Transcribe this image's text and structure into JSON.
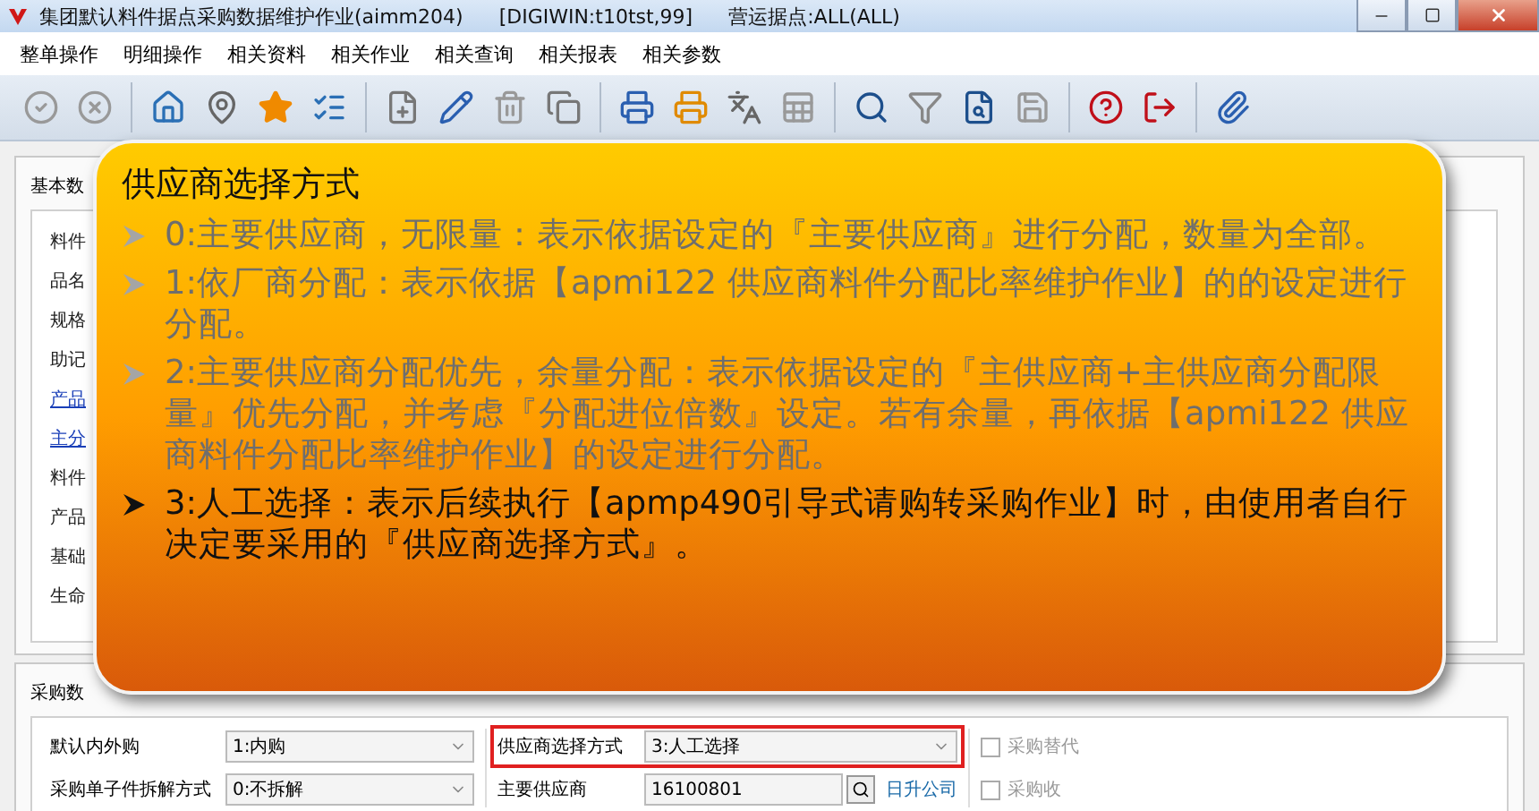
{
  "window": {
    "title": "集团默认料件据点采购数据维护作业(aimm204)",
    "connection": "[DIGIWIN:t10tst,99]",
    "site": "营运据点:ALL(ALL)"
  },
  "menu": [
    "整单操作",
    "明细操作",
    "相关资料",
    "相关作业",
    "相关查询",
    "相关报表",
    "相关参数"
  ],
  "basic_tab": {
    "label": "基本数"
  },
  "basic_labels": [
    {
      "text": "料件",
      "kind": "plain"
    },
    {
      "text": "品名",
      "kind": "plain"
    },
    {
      "text": "规格",
      "kind": "plain"
    },
    {
      "text": "助记",
      "kind": "plain"
    },
    {
      "text": "产品",
      "kind": "link"
    },
    {
      "text": "主分",
      "kind": "link"
    },
    {
      "text": "料件",
      "kind": "plain"
    },
    {
      "text": "产品",
      "kind": "plain"
    },
    {
      "text": "基础",
      "kind": "plain"
    },
    {
      "text": "生命",
      "kind": "plain"
    }
  ],
  "purchase_tab": {
    "label": "采购数"
  },
  "left_fields": [
    {
      "label": "默认内外购",
      "value": "1:内购"
    },
    {
      "label": "采购单子件拆解方式",
      "value": "0:不拆解"
    }
  ],
  "supplier_method": {
    "label": "供应商选择方式",
    "value": "3:人工选择",
    "highlighted": true
  },
  "main_supplier": {
    "label": "主要供应商",
    "value": "16100801",
    "name": "日升公司"
  },
  "checkboxes": [
    {
      "label": "采购替代",
      "checked": false
    },
    {
      "label": "采购收",
      "checked": false
    }
  ],
  "callout": {
    "title": "供应商选择方式",
    "items": [
      {
        "text": "0:主要供应商，无限量：表示依据设定的『主要供应商』进行分配，数量为全部。",
        "selected": false
      },
      {
        "text": "1:依厂商分配：表示依据【apmi122 供应商料件分配比率维护作业】的的设定进行分配。",
        "selected": false
      },
      {
        "text": "2:主要供应商分配优先，余量分配：表示依据设定的『主供应商+主供应商分配限量』优先分配，并考虑『分配进位倍数』设定。若有余量，再依据【apmi122 供应商料件分配比率维护作业】的设定进行分配。",
        "selected": false
      },
      {
        "text": "3:人工选择：表示后续执行【apmp490引导式请购转采购作业】时，由使用者自行决定要采用的『供应商选择方式』。",
        "selected": true
      }
    ]
  }
}
